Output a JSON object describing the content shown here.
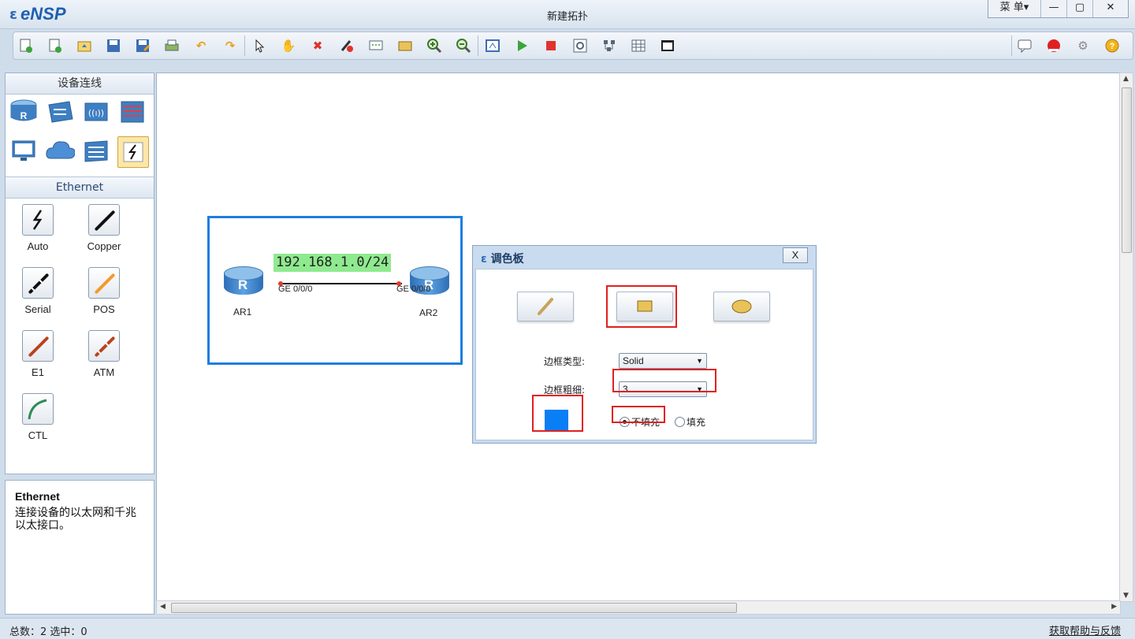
{
  "app": {
    "logo_mark": "ε",
    "logo_text": "eNSP",
    "window_title": "新建拓扑"
  },
  "window_controls": {
    "menu": "菜 单▾",
    "minimize": "—",
    "maximize": "▢",
    "close": "✕"
  },
  "toolbar": {
    "left_icons": [
      "new-topology-icon",
      "new-example-icon",
      "open-icon",
      "save-icon",
      "save-as-icon",
      "print-icon",
      "undo-icon",
      "redo-icon",
      "select-icon",
      "hand-icon",
      "delete-icon",
      "delete-link-icon",
      "text-note-icon",
      "palette-icon",
      "zoom-in-icon",
      "zoom-out-icon",
      "fit-window-icon",
      "start-device-icon",
      "stop-device-icon",
      "capture-icon",
      "topology-icon",
      "grid-icon",
      "screenshot-icon"
    ],
    "right_icons": [
      "chat-icon",
      "huawei-icon",
      "settings-icon",
      "help-icon"
    ]
  },
  "sidebar": {
    "device_section_title": "设备连线",
    "device_icons": [
      "router-icon",
      "switch-icon",
      "wireless-icon",
      "firewall-icon",
      "pc-icon",
      "cloud-icon",
      "other-device-icon",
      "connection-icon"
    ],
    "cable_section_title": "Ethernet",
    "cables": [
      {
        "label": "Auto",
        "icon": "auto-cable-icon",
        "color": "#111111"
      },
      {
        "label": "Copper",
        "icon": "copper-cable-icon",
        "color": "#111111"
      },
      {
        "label": "Serial",
        "icon": "serial-cable-icon",
        "color": "#111111"
      },
      {
        "label": "POS",
        "icon": "pos-cable-icon",
        "color": "#f39a2b"
      },
      {
        "label": "E1",
        "icon": "e1-cable-icon",
        "color": "#b8441f"
      },
      {
        "label": "ATM",
        "icon": "atm-cable-icon",
        "color": "#b8441f"
      },
      {
        "label": "CTL",
        "icon": "ctl-cable-icon",
        "color": "#2e8b57"
      }
    ]
  },
  "description": {
    "title": "Ethernet",
    "text": "连接设备的以太网和千兆以太接口。"
  },
  "topology": {
    "network_label": "192.168.1.0/24",
    "routers": [
      {
        "name": "AR1",
        "letter": "R",
        "port": "GE 0/0/0"
      },
      {
        "name": "AR2",
        "letter": "R",
        "port": "GE 0/0/0"
      }
    ],
    "area_border_color": "#1e7ee0"
  },
  "palette_dialog": {
    "title": "调色板",
    "close_label": "X",
    "shapes": [
      "line-shape-icon",
      "rectangle-shape-icon",
      "ellipse-shape-icon"
    ],
    "selected_shape": "rectangle-shape-icon",
    "border_type_label": "边框类型:",
    "border_type_value": "Solid",
    "border_width_label": "边框粗细:",
    "border_width_value": "3",
    "color_swatch": "#0a7ef5",
    "no_fill_label": "不填充",
    "fill_label": "填充",
    "fill_selected": "不填充"
  },
  "status": {
    "text": "总数：2  选中：0",
    "help_link": "获取帮助与反馈"
  },
  "colors": {
    "accent": "#1e7ee0",
    "highlight": "#e02020"
  }
}
